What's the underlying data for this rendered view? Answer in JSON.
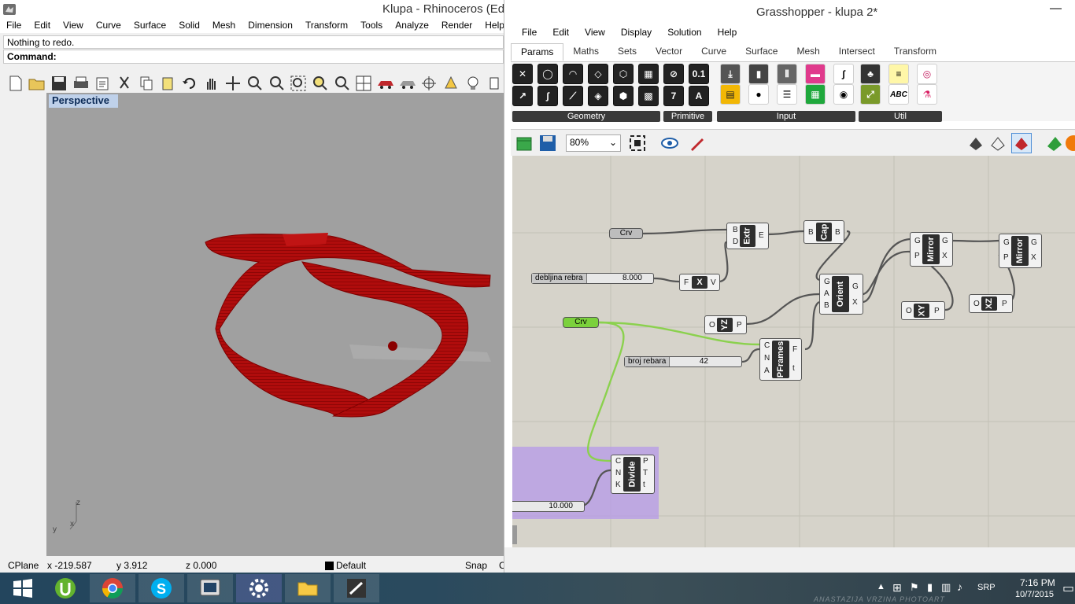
{
  "rhino": {
    "title": "Klupa - Rhinoceros (Edu",
    "menu": [
      "File",
      "Edit",
      "View",
      "Curve",
      "Surface",
      "Solid",
      "Mesh",
      "Dimension",
      "Transform",
      "Tools",
      "Analyze",
      "Render",
      "Help"
    ],
    "history_line": "Nothing to redo.",
    "command_label": "Command:",
    "viewport_label": "Perspective",
    "axis_z": "z",
    "axis_y": "y",
    "axis_x": "x",
    "status": {
      "cplane": "CPlane",
      "x": "x -219.587",
      "y": "y 3.912",
      "z": "z 0.000",
      "layer": "Default",
      "snap": "Snap",
      "overflow": "C"
    }
  },
  "grasshopper": {
    "title": "Grasshopper - klupa 2*",
    "minimize": "—",
    "menu": [
      "File",
      "Edit",
      "View",
      "Display",
      "Solution",
      "Help"
    ],
    "tabs": [
      "Params",
      "Maths",
      "Sets",
      "Vector",
      "Curve",
      "Surface",
      "Mesh",
      "Intersect",
      "Transform"
    ],
    "groups": {
      "geometry": "Geometry",
      "primitive": "Primitive",
      "input": "Input",
      "util": "Util"
    },
    "primitive_icons": [
      "0.1",
      "7",
      "A"
    ],
    "util_icons": [
      "ABC"
    ],
    "zoom": "80%",
    "components": {
      "crv1": "Crv",
      "crv2": "Crv",
      "extr": "Extr",
      "extr_in": [
        "B",
        "D"
      ],
      "extr_out": "E",
      "cap": "Cap",
      "cap_in": "B",
      "cap_out": "B",
      "x": "X",
      "x_in": "F",
      "x_out": "V",
      "orient": "Orient",
      "orient_in": [
        "G",
        "A",
        "B"
      ],
      "orient_out": [
        "G",
        "X"
      ],
      "mirror1": "Mirror",
      "mirror1_in": [
        "G",
        "P"
      ],
      "mirror1_out": [
        "G",
        "X"
      ],
      "mirror2": "Mirror",
      "mirror2_in": [
        "G",
        "P"
      ],
      "mirror2_out": [
        "G",
        "X"
      ],
      "yz": "YZ",
      "yz_in": "O",
      "yz_out": "P",
      "xy": "XY",
      "xy_in": "O",
      "xy_out": "P",
      "xz": "XZ",
      "xz_in": "O",
      "xz_out": "P",
      "pframes": "PFrames",
      "pframes_in": [
        "C",
        "N",
        "A"
      ],
      "pframes_out": [
        "F",
        "t"
      ],
      "divide": "Divide",
      "divide_in": [
        "C",
        "N",
        "K"
      ],
      "divide_out": [
        "P",
        "T",
        "t"
      ]
    },
    "sliders": {
      "debljina": {
        "name": "debljina rebra",
        "value": "8.000"
      },
      "broj": {
        "name": "broj rebara",
        "value": "42"
      },
      "divide_count": {
        "name": "",
        "value": "10.000"
      }
    }
  },
  "taskbar": {
    "lang": "SRP",
    "time": "7:16 PM",
    "date": "10/7/2015",
    "watermark": "ANASTAZIJA VRZINA PHOTOART"
  }
}
